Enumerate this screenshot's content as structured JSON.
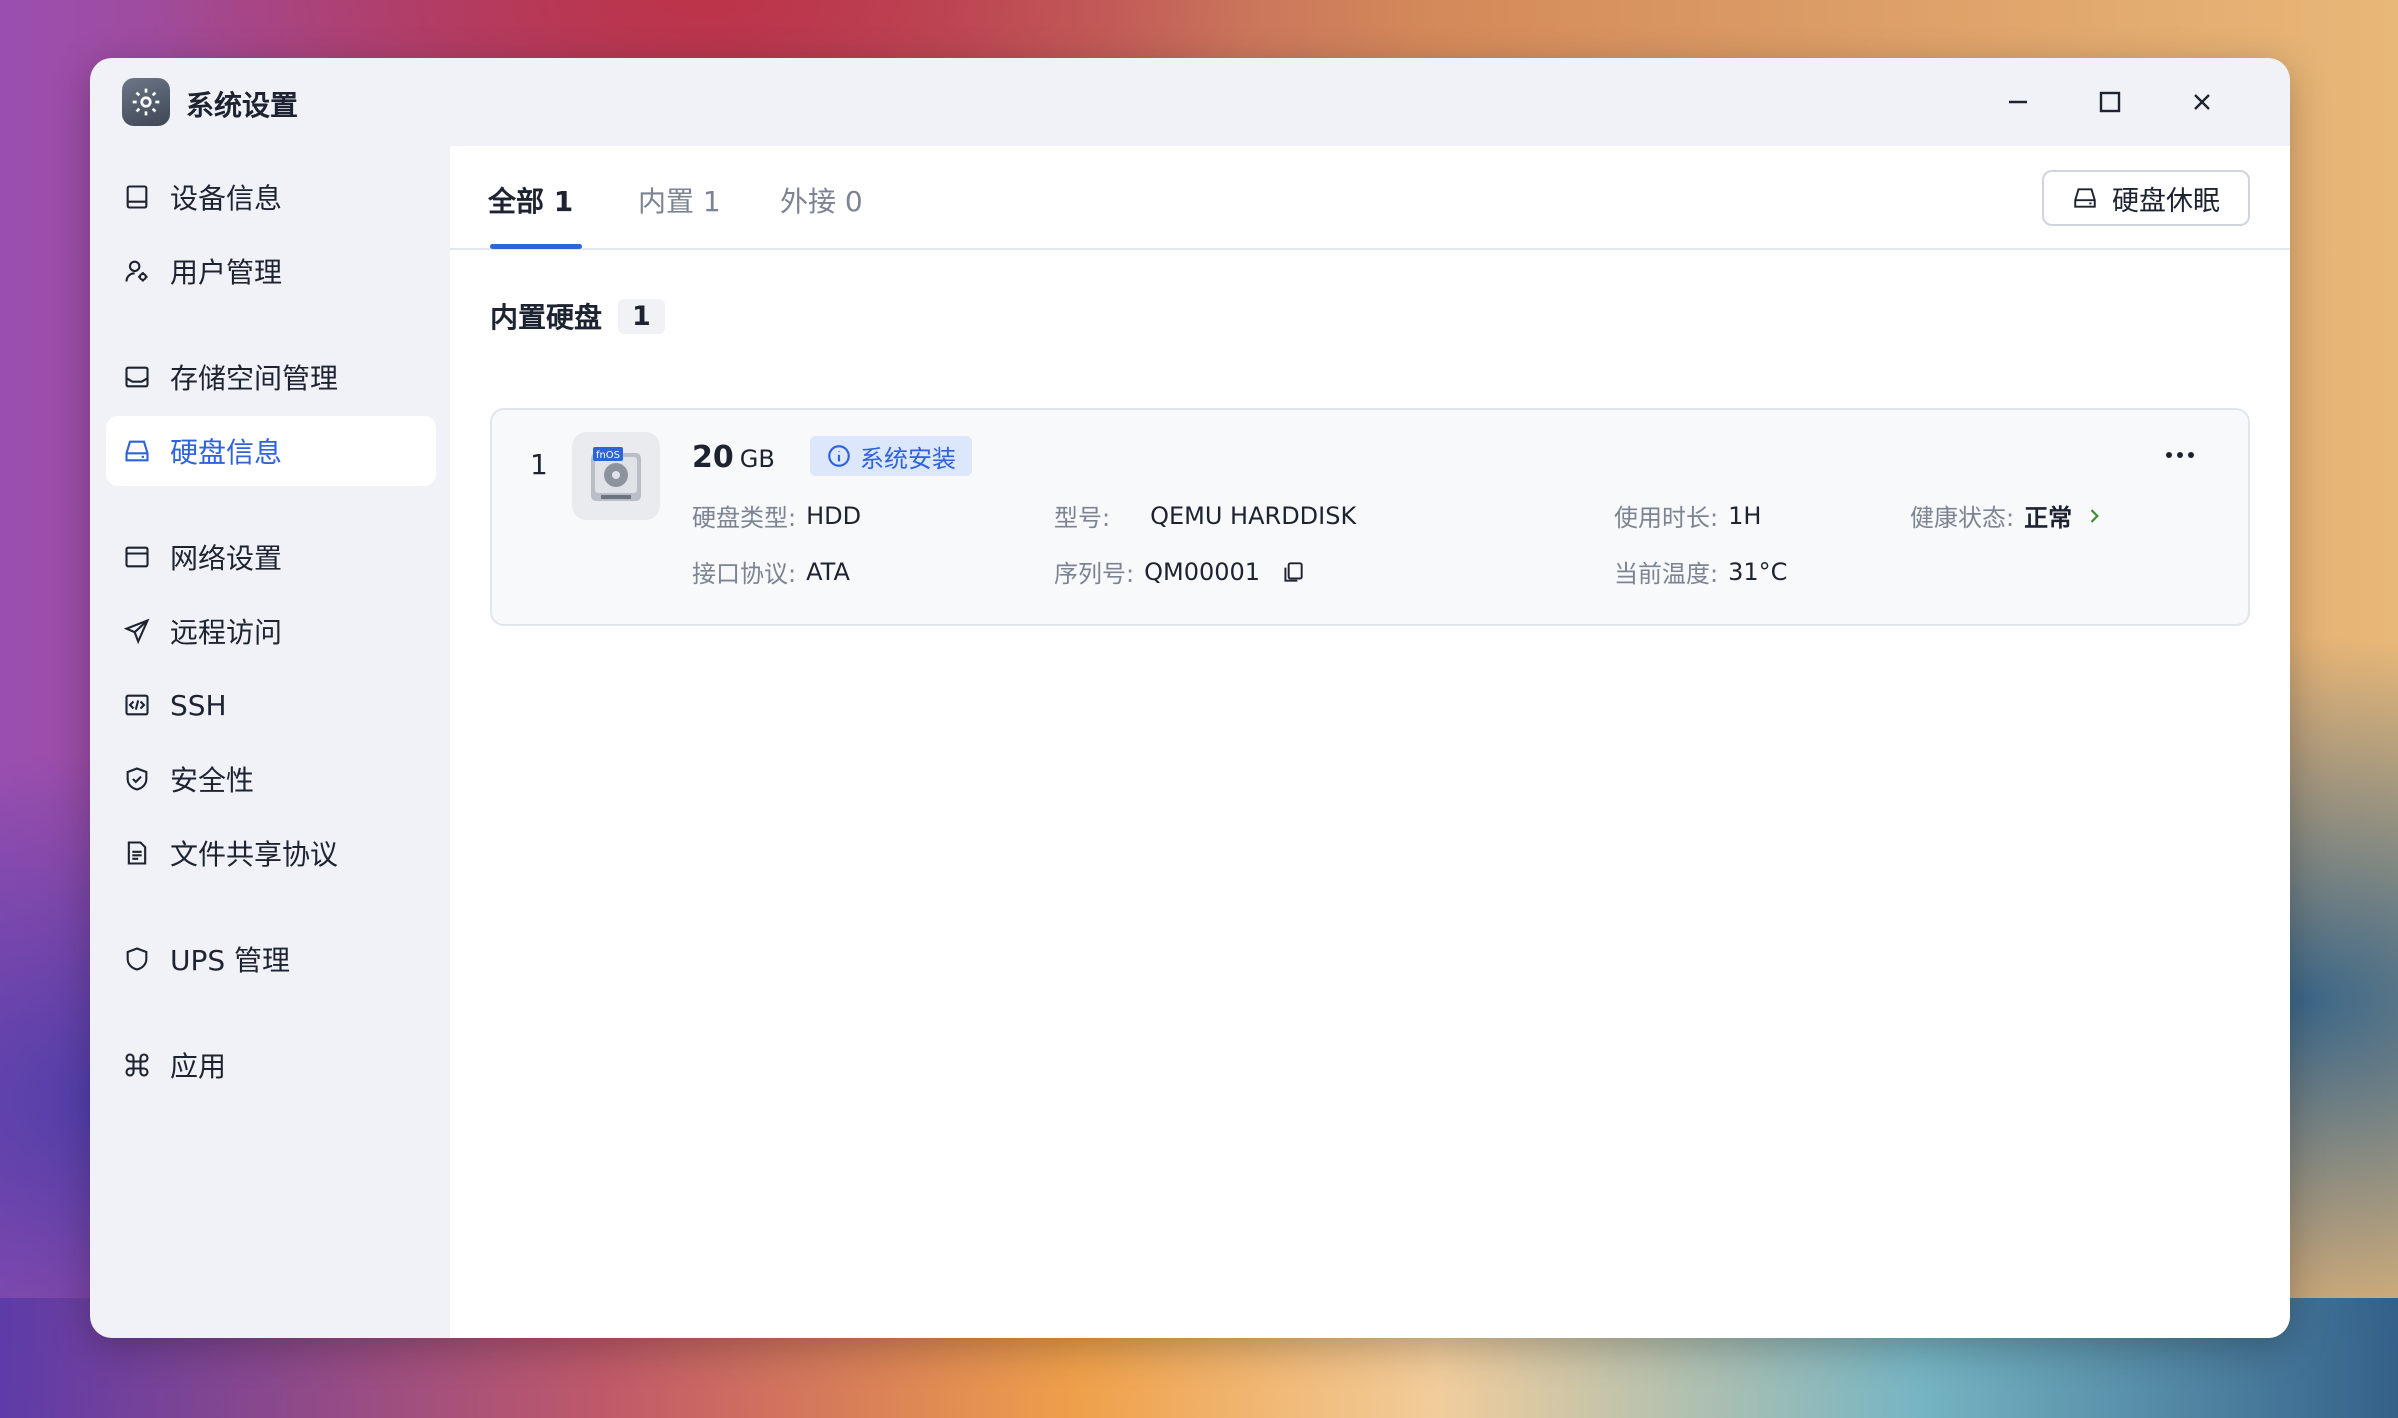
{
  "window": {
    "title": "系统设置",
    "app_icon": "gear-icon"
  },
  "window_controls": {
    "minimize": "minimize-icon",
    "maximize": "maximize-icon",
    "close": "close-icon"
  },
  "sidebar": {
    "items": [
      {
        "label": "设备信息",
        "icon": "device-icon"
      },
      {
        "label": "用户管理",
        "icon": "user-icon"
      },
      {
        "label": "存储空间管理",
        "icon": "storage-icon"
      },
      {
        "label": "硬盘信息",
        "icon": "disk-icon",
        "active": true
      },
      {
        "label": "网络设置",
        "icon": "network-icon"
      },
      {
        "label": "远程访问",
        "icon": "send-icon"
      },
      {
        "label": "SSH",
        "icon": "code-icon"
      },
      {
        "label": "安全性",
        "icon": "shield-check-icon"
      },
      {
        "label": "文件共享协议",
        "icon": "document-icon"
      },
      {
        "label": "UPS 管理",
        "icon": "shield-icon"
      },
      {
        "label": "应用",
        "icon": "command-icon"
      }
    ]
  },
  "tabs": [
    {
      "label": "全部 1",
      "active": true
    },
    {
      "label": "内置 1"
    },
    {
      "label": "外接 0"
    }
  ],
  "toolbar": {
    "sleep_label": "硬盘休眠"
  },
  "section": {
    "title": "内置硬盘",
    "count": "1"
  },
  "disk": {
    "index": "1",
    "icon_brand": "fnOS",
    "size": "20",
    "unit": "GB",
    "badge": "系统安装",
    "type_label": "硬盘类型:",
    "type_value": "HDD",
    "interface_label": "接口协议:",
    "interface_value": "ATA",
    "model_label": "型号:",
    "model_value": "QEMU HARDDISK",
    "serial_label": "序列号:",
    "serial_value": "QM00001",
    "usage_label": "使用时长:",
    "usage_value": "1H",
    "temp_label": "当前温度:",
    "temp_value": "31°C",
    "health_label": "健康状态:",
    "health_value": "正常",
    "health_color": "#3a8f2c"
  },
  "colors": {
    "accent": "#2f63d9",
    "success": "#3a8f2c"
  }
}
